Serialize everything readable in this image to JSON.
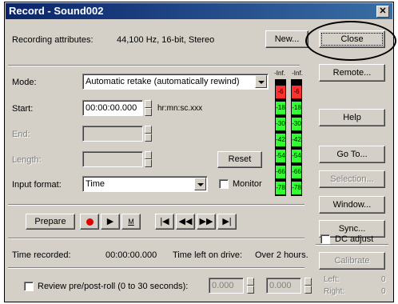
{
  "window": {
    "title": "Record - Sound002"
  },
  "attributes": {
    "label": "Recording attributes:",
    "value": "44,100 Hz, 16-bit, Stereo",
    "new_button": "New..."
  },
  "mode": {
    "label": "Mode:",
    "value": "Automatic retake (automatically rewind)"
  },
  "start": {
    "label": "Start:",
    "value": "00:00:00.000",
    "format": "hr:mn:sc.xxx"
  },
  "end": {
    "label": "End:"
  },
  "length": {
    "label": "Length:"
  },
  "reset_button": "Reset",
  "input_format": {
    "label": "Input format:",
    "value": "Time"
  },
  "monitor": {
    "label": "Monitor",
    "checked": false
  },
  "meter": {
    "ticks": [
      "-Inf.",
      "-Inf."
    ],
    "levels": [
      "-6",
      "-18",
      "-30",
      "-42",
      "-54",
      "-66",
      "-78"
    ],
    "colors": {
      "top": "#ff3030",
      "mid": "#30ff30",
      "low": "#40ff40"
    }
  },
  "transport": {
    "prepare": "Prepare",
    "record_icon": "record-icon",
    "play_icon": "play-icon",
    "marker_label": "M"
  },
  "status": {
    "recorded_label": "Time recorded:",
    "recorded_value": "00:00:00.000",
    "left_label": "Time left on drive:",
    "left_value": "Over 2 hours."
  },
  "review": {
    "label": "Review pre/post-roll (0 to 30 seconds):",
    "pre": "0.000",
    "post": "0.000"
  },
  "side_buttons": {
    "close": "Close",
    "remote": "Remote...",
    "help": "Help",
    "goto": "Go To...",
    "selection": "Selection...",
    "window": "Window...",
    "sync": "Sync...",
    "dc_adjust": "DC adjust",
    "calibrate": "Calibrate"
  },
  "dc": {
    "left_label": "Left:",
    "left_value": "0",
    "right_label": "Right:",
    "right_value": "0"
  }
}
